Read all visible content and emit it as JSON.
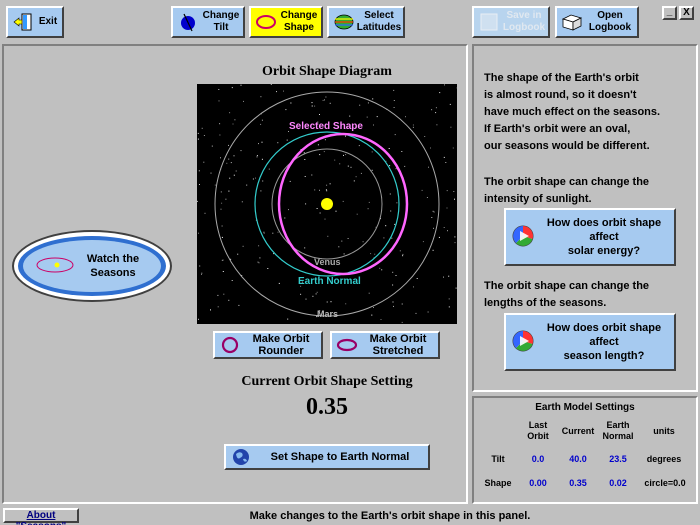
{
  "toolbar": {
    "exit": "Exit",
    "change_tilt": "Change\nTilt",
    "change_shape": "Change\nShape",
    "select_latitudes": "Select\nLatitudes",
    "save_logbook": "Save in\nLogbook",
    "open_logbook": "Open\nLogbook"
  },
  "window_controls": {
    "minimize": "_",
    "close": "X"
  },
  "watch": {
    "label": "Watch the\nSeasons"
  },
  "diagram": {
    "title": "Orbit Shape Diagram",
    "selected_label": "Selected Shape",
    "venus_label": "Venus",
    "earth_label": "Earth Normal",
    "mars_label": "Mars"
  },
  "buttons": {
    "rounder": "Make Orbit\nRounder",
    "stretched": "Make Orbit\nStretched",
    "set_normal": "Set Shape to Earth Normal"
  },
  "current": {
    "heading": "Current Orbit Shape Setting",
    "value": "0.35"
  },
  "info": {
    "para1": "The shape of the Earth's orbit\nis almost round, so it doesn't\nhave much effect on the seasons.\nIf Earth's orbit were an oval,\nour seasons would be different.",
    "para2": "The orbit shape can change the\nintensity of sunlight.",
    "btn_energy": "How does orbit shape\naffect\nsolar energy?",
    "para3": "The orbit shape can change the\nlengths of the seasons.",
    "btn_length": "How does orbit shape\naffect\nseason length?"
  },
  "settings": {
    "title": "Earth Model Settings",
    "col_last": "Last\nOrbit",
    "col_current": "Current",
    "col_normal": "Earth\nNormal",
    "col_units": "units",
    "tilt_label": "Tilt",
    "tilt_last": "0.0",
    "tilt_current": "40.0",
    "tilt_normal": "23.5",
    "tilt_units": "degrees",
    "shape_label": "Shape",
    "shape_last": "0.00",
    "shape_current": "0.35",
    "shape_normal": "0.02",
    "shape_units": "circle=0.0"
  },
  "status": {
    "about": "About \"Seasons\"",
    "message": "Make changes to the Earth's orbit shape in this panel."
  },
  "colors": {
    "button_blue": "#a6caf0",
    "active_yellow": "#ffff00",
    "orbit_magenta": "#ff66ff",
    "earth_cyan": "#33cccc",
    "sun_yellow": "#ffff00"
  }
}
